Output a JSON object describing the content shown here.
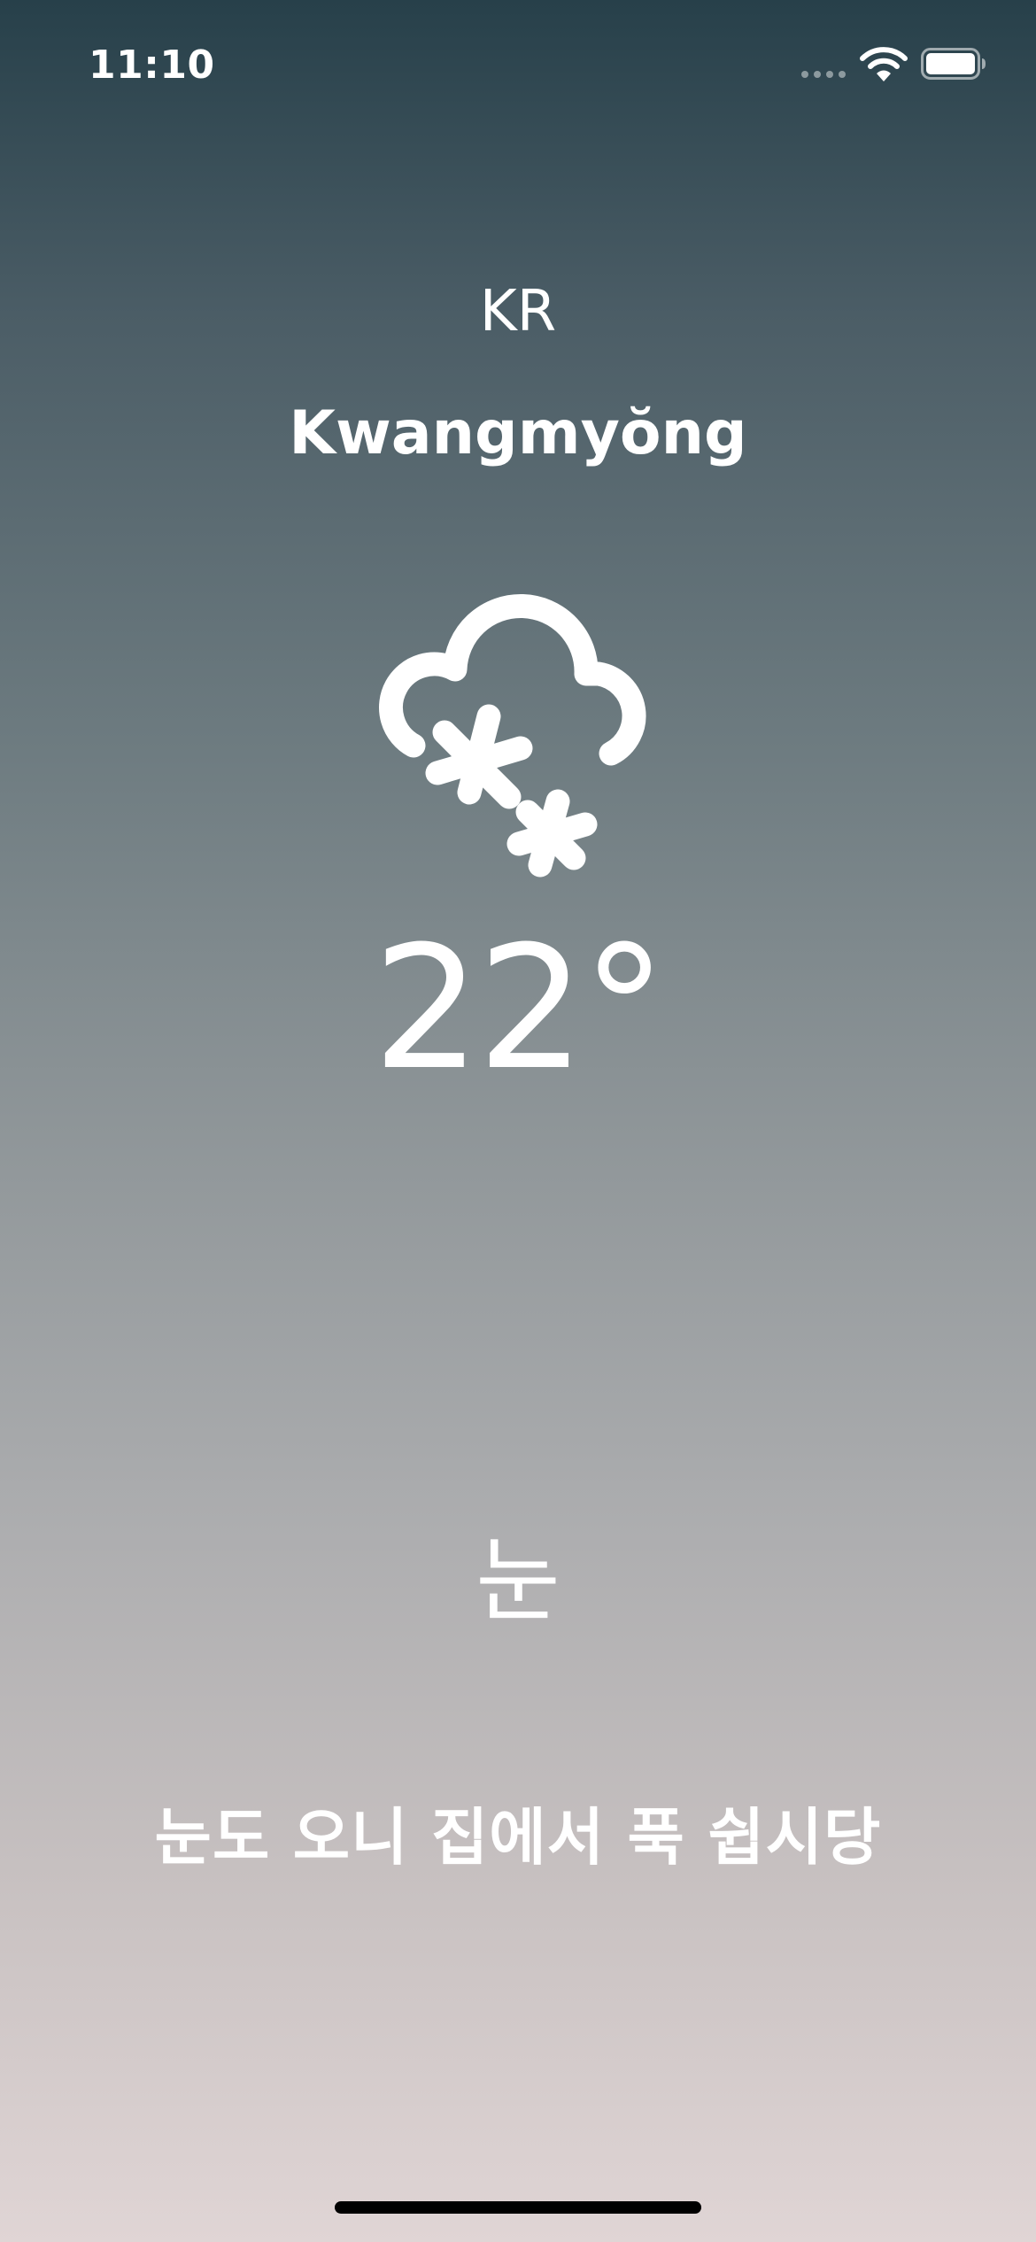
{
  "status_bar": {
    "time": "11:10",
    "icons": [
      "signal-dots-icon",
      "wifi-icon",
      "battery-icon"
    ]
  },
  "weather": {
    "country_code": "KR",
    "city": "Kwangmyŏng",
    "icon": "snow-cloud-icon",
    "temperature": "22°",
    "condition": "눈",
    "message": "눈도 오니 집에서 푹 쉽시당"
  },
  "colors": {
    "background_top": "#27404a",
    "background_bottom": "#e0d5d5",
    "text": "#ffffff"
  }
}
